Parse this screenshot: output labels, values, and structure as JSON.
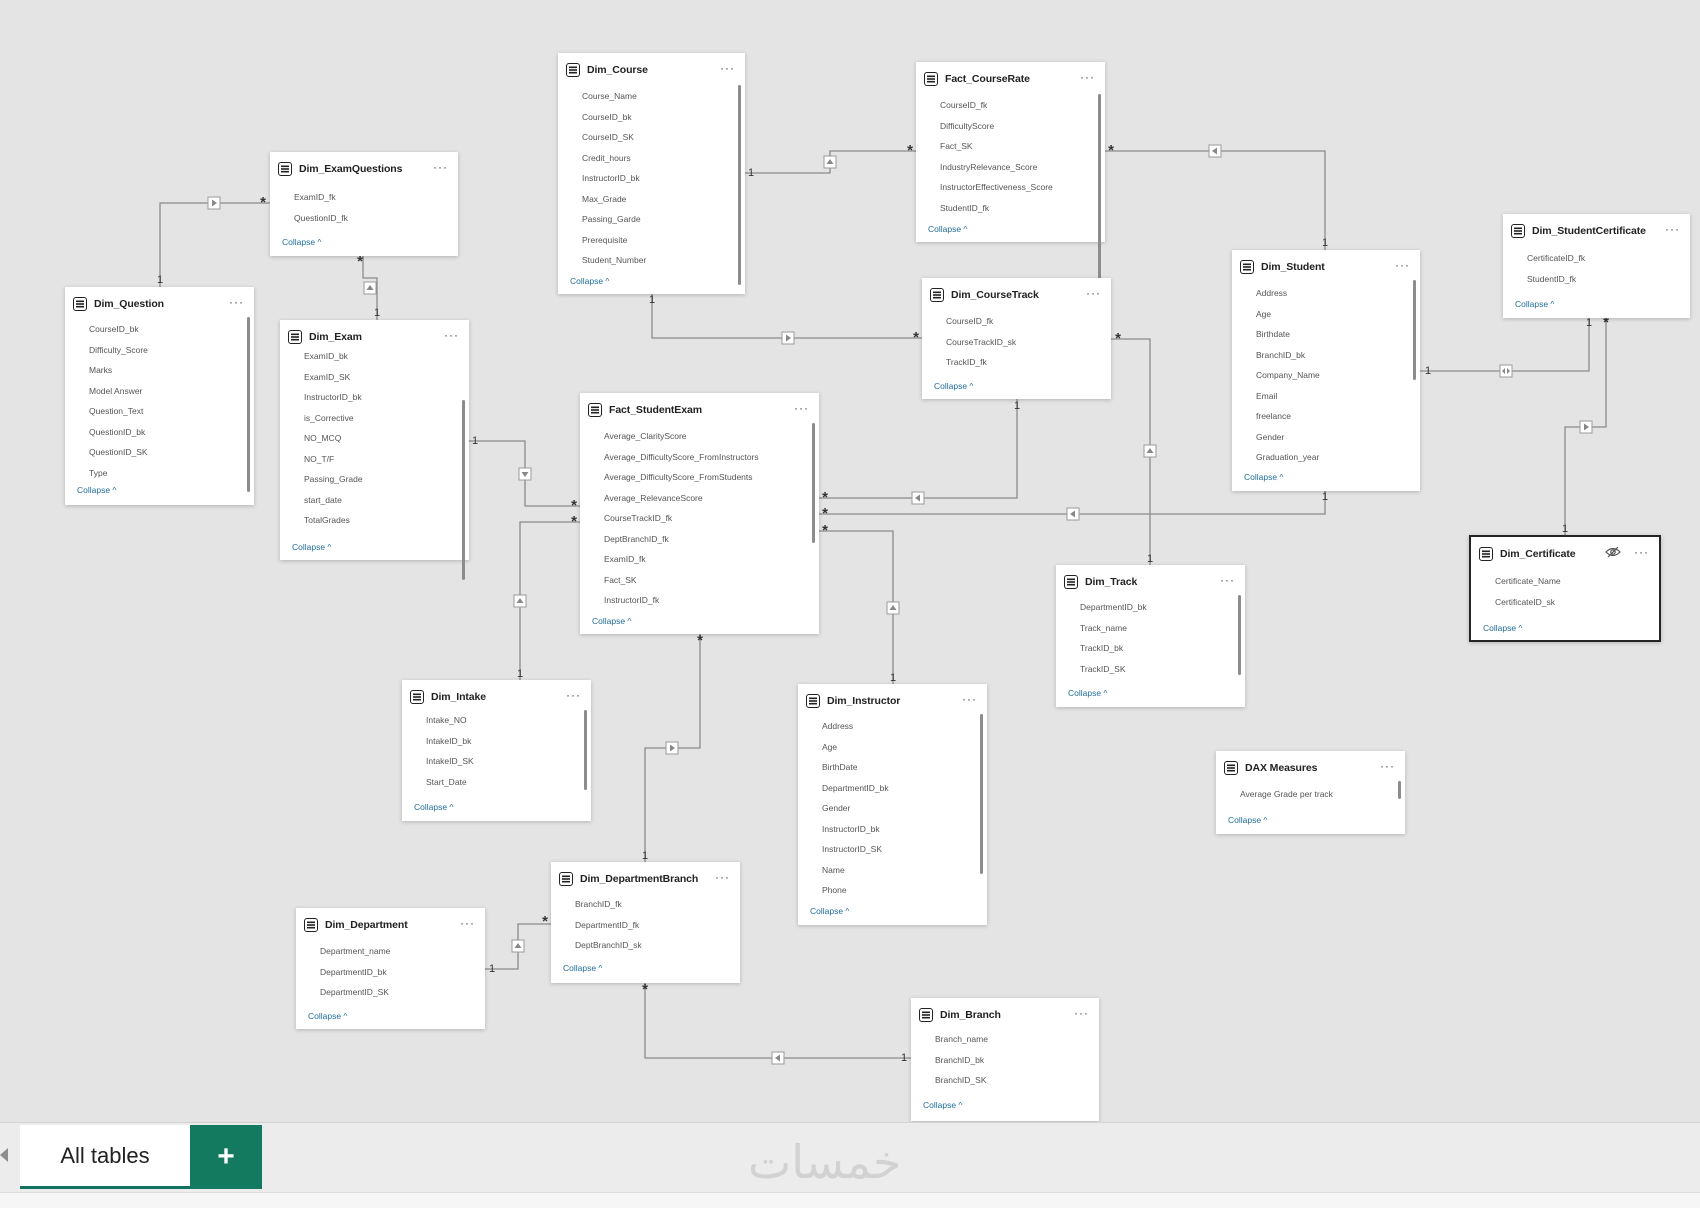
{
  "tables": [
    {
      "id": "dim-course",
      "title": "Dim_Course",
      "fields": [
        "Course_Name",
        "CourseID_bk",
        "CourseID_SK",
        "Credit_hours",
        "InstructorID_bk",
        "Max_Grade",
        "Passing_Garde",
        "Prerequisite",
        "Student_Number"
      ],
      "collapse": "Collapse ^"
    },
    {
      "id": "fact-courserate",
      "title": "Fact_CourseRate",
      "fields": [
        "CourseID_fk",
        "DifficultyScore",
        "Fact_SK",
        "IndustryRelevance_Score",
        "InstructorEffectiveness_Score",
        "StudentID_fk"
      ],
      "collapse": "Collapse ^"
    },
    {
      "id": "dim-examquestions",
      "title": "Dim_ExamQuestions",
      "fields": [
        "ExamID_fk",
        "QuestionID_fk"
      ],
      "collapse": "Collapse ^"
    },
    {
      "id": "dim-question",
      "title": "Dim_Question",
      "fields": [
        "CourseID_bk",
        "Difficulty_Score",
        "Marks",
        "Model Answer",
        "Question_Text",
        "QuestionID_bk",
        "QuestionID_SK",
        "Type"
      ],
      "collapse": "Collapse ^"
    },
    {
      "id": "dim-exam",
      "title": "Dim_Exam",
      "fields": [
        "ExamID_bk",
        "ExamID_SK",
        "InstructorID_bk",
        "is_Corrective",
        "NO_MCQ",
        "NO_T/F",
        "Passing_Grade",
        "start_date",
        "TotalGrades"
      ],
      "collapse": "Collapse ^"
    },
    {
      "id": "fact-studentexam",
      "title": "Fact_StudentExam",
      "fields": [
        "Average_ClarityScore",
        "Average_DifficultyScore_FromInstructors",
        "Average_DifficultyScore_FromStudents",
        "Average_RelevanceScore",
        "CourseTrackID_fk",
        "DeptBranchID_fk",
        "ExamID_fk",
        "Fact_SK",
        "InstructorID_fk"
      ],
      "collapse": "Collapse ^"
    },
    {
      "id": "dim-coursetrack",
      "title": "Dim_CourseTrack",
      "fields": [
        "CourseID_fk",
        "CourseTrackID_sk",
        "TrackID_fk"
      ],
      "collapse": "Collapse ^"
    },
    {
      "id": "dim-student",
      "title": "Dim_Student",
      "fields": [
        "Address",
        "Age",
        "Birthdate",
        "BranchID_bk",
        "Company_Name",
        "Email",
        "freelance",
        "Gender",
        "Graduation_year"
      ],
      "collapse": "Collapse ^"
    },
    {
      "id": "dim-studentcertificate",
      "title": "Dim_StudentCertificate",
      "fields": [
        "CertificateID_fk",
        "StudentID_fk"
      ],
      "collapse": "Collapse ^"
    },
    {
      "id": "dim-certificate",
      "title": "Dim_Certificate",
      "fields": [
        "Certificate_Name",
        "CertificateID_sk"
      ],
      "collapse": "Collapse ^"
    },
    {
      "id": "dim-track",
      "title": "Dim_Track",
      "fields": [
        "DepartmentID_bk",
        "Track_name",
        "TrackID_bk",
        "TrackID_SK"
      ],
      "collapse": "Collapse ^"
    },
    {
      "id": "dim-intake",
      "title": "Dim_Intake",
      "fields": [
        "Intake_NO",
        "IntakeID_bk",
        "IntakeID_SK",
        "Start_Date"
      ],
      "collapse": "Collapse ^"
    },
    {
      "id": "dim-instructor",
      "title": "Dim_Instructor",
      "fields": [
        "Address",
        "Age",
        "BirthDate",
        "DepartmentID_bk",
        "Gender",
        "InstructorID_bk",
        "InstructorID_SK",
        "Name",
        "Phone"
      ],
      "collapse": "Collapse ^"
    },
    {
      "id": "dax-measures",
      "title": "DAX Measures",
      "fields": [
        "Average Grade per track"
      ],
      "collapse": "Collapse ^"
    },
    {
      "id": "dim-departmentbranch",
      "title": "Dim_DepartmentBranch",
      "fields": [
        "BranchID_fk",
        "DepartmentID_fk",
        "DeptBranchID_sk"
      ],
      "collapse": "Collapse ^"
    },
    {
      "id": "dim-department",
      "title": "Dim_Department",
      "fields": [
        "Department_name",
        "DepartmentID_bk",
        "DepartmentID_SK"
      ],
      "collapse": "Collapse ^"
    },
    {
      "id": "dim-branch",
      "title": "Dim_Branch",
      "fields": [
        "Branch_name",
        "BranchID_bk",
        "BranchID_SK"
      ],
      "collapse": "Collapse ^"
    }
  ],
  "cardinality": {
    "one": "1",
    "many": "*"
  },
  "tabs": {
    "active_label": "All tables",
    "add_label": "+"
  },
  "watermark": "خمسات"
}
